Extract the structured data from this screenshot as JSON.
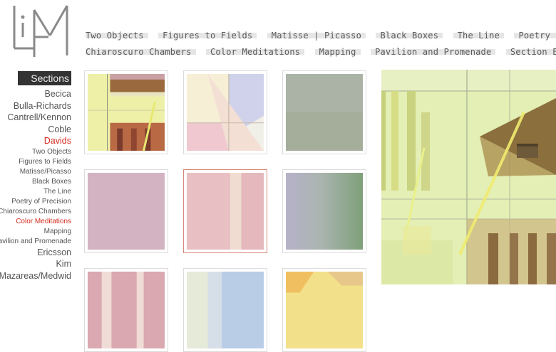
{
  "logo": {
    "icon": "lim-logo-icon",
    "text": "LiM"
  },
  "topnav": {
    "row1": [
      "Two Objects",
      "Figures to Fields",
      "Matisse | Picasso",
      "Black Boxes",
      "The Line",
      "Poetry of Precision"
    ],
    "row2": [
      "Chiaroscuro Chambers",
      "Color Meditations",
      "Mapping",
      "Pavilion and Promenade",
      "Section Exercises"
    ]
  },
  "sidebar": {
    "heading": "Sections",
    "items": [
      {
        "label": "Becica",
        "type": "major",
        "active": false
      },
      {
        "label": "Bulla-Richards",
        "type": "major",
        "active": false
      },
      {
        "label": "Cantrell/Kennon",
        "type": "major",
        "active": false
      },
      {
        "label": "Coble",
        "type": "major",
        "active": false
      },
      {
        "label": "Davids",
        "type": "major",
        "active": true
      },
      {
        "label": "Two Objects",
        "type": "minor",
        "active": false
      },
      {
        "label": "Figures to Fields",
        "type": "minor",
        "active": false
      },
      {
        "label": "Matisse/Picasso",
        "type": "minor",
        "active": false
      },
      {
        "label": "Black Boxes",
        "type": "minor",
        "active": false
      },
      {
        "label": "The Line",
        "type": "minor",
        "active": false
      },
      {
        "label": "Poetry of Precision",
        "type": "minor",
        "active": false
      },
      {
        "label": "Chiaroscuro Chambers",
        "type": "minor",
        "active": false
      },
      {
        "label": "Color Meditations",
        "type": "minor",
        "active": true
      },
      {
        "label": "Mapping",
        "type": "minor",
        "active": false
      },
      {
        "label": "Pavilion and Promenade",
        "type": "minor",
        "active": false
      },
      {
        "label": "Ericsson",
        "type": "major",
        "active": false
      },
      {
        "label": "Kim",
        "type": "major",
        "active": false
      },
      {
        "label": "Mazareas/Medwid",
        "type": "major",
        "active": false
      }
    ]
  },
  "colors": {
    "active": "#d52a1e",
    "heading_bg": "#333333",
    "nav_highlight": "#e6e6e6",
    "main_image_bg": "#e2efb2"
  }
}
